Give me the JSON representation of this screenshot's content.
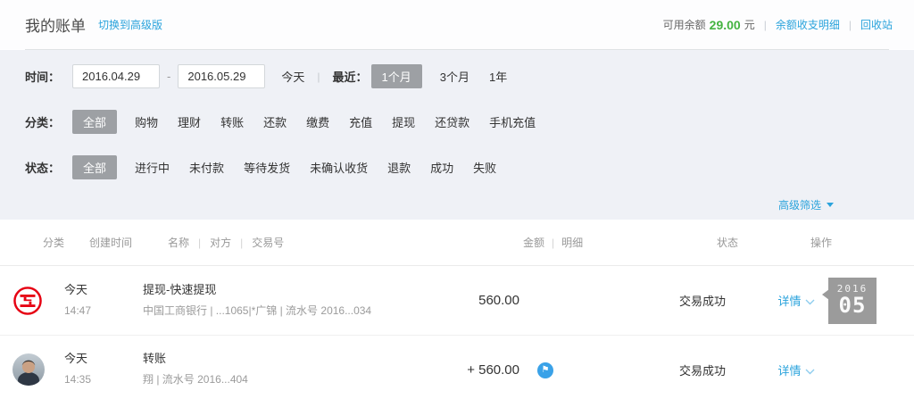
{
  "ui": {
    "pipe": "|",
    "dash": "-"
  },
  "header": {
    "title": "我的账单",
    "switch_link": "切换到高级版",
    "balance_label": "可用余额",
    "balance_value": "29.00",
    "balance_unit": "元",
    "balance_detail_link": "余额收支明细",
    "recycle_link": "回收站"
  },
  "filters": {
    "time": {
      "label": "时间：",
      "date_from": "2016.04.29",
      "date_to": "2016.05.29",
      "today": "今天",
      "recent_label": "最近：",
      "range_1m": "1个月",
      "range_3m": "3个月",
      "range_1y": "1年",
      "selected_range": "1个月"
    },
    "category": {
      "label": "分类：",
      "options": [
        "全部",
        "购物",
        "理财",
        "转账",
        "还款",
        "缴费",
        "充值",
        "提现",
        "还贷款",
        "手机充值"
      ],
      "selected": "全部"
    },
    "status": {
      "label": "状态：",
      "options": [
        "全部",
        "进行中",
        "未付款",
        "等待发货",
        "未确认收货",
        "退款",
        "成功",
        "失败"
      ],
      "selected": "全部"
    },
    "advanced": "高级筛选"
  },
  "table": {
    "headers": {
      "category": "分类",
      "created": "创建时间",
      "name": "名称",
      "counterparty": "对方",
      "txn": "交易号",
      "amount": "金额",
      "detail": "明细",
      "status": "状态",
      "action": "操作"
    },
    "rows": [
      {
        "icon": "icbc-bank-logo",
        "date": "今天",
        "time": "14:47",
        "title": "提现-快速提现",
        "subtitle": "中国工商银行 | ...1065|*广锦 | 流水号 2016...034",
        "amount": "560.00",
        "status": "交易成功",
        "action": "详情",
        "badge": {
          "year": "2016",
          "month": "05"
        }
      },
      {
        "icon": "user-avatar",
        "date": "今天",
        "time": "14:35",
        "title": "转账",
        "subtitle": "翔 | 流水号 2016...404",
        "amount": "+ 560.00",
        "flag_icon": "⚑",
        "status": "交易成功",
        "action": "详情"
      }
    ]
  },
  "colors": {
    "link_blue": "#2aa3dc",
    "balance_green": "#44b340",
    "selected_chip_gray": "#9da0a4",
    "badge_gray": "#9b9b9b",
    "icbc_red": "#e60012",
    "flag_blue": "#3aa2e8"
  }
}
